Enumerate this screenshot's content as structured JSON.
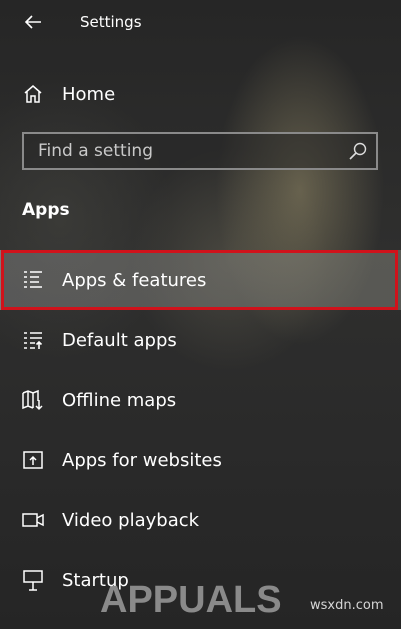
{
  "window": {
    "title": "Settings"
  },
  "home": {
    "label": "Home"
  },
  "search": {
    "placeholder": "Find a setting",
    "value": ""
  },
  "section": {
    "title": "Apps"
  },
  "nav": {
    "items": [
      {
        "label": "Apps & features",
        "icon": "apps-features-icon",
        "selected": true
      },
      {
        "label": "Default apps",
        "icon": "default-apps-icon"
      },
      {
        "label": "Offline maps",
        "icon": "offline-maps-icon"
      },
      {
        "label": "Apps for websites",
        "icon": "apps-for-websites-icon"
      },
      {
        "label": "Video playback",
        "icon": "video-playback-icon"
      },
      {
        "label": "Startup",
        "icon": "startup-icon"
      }
    ]
  },
  "colors": {
    "highlight": "#d0121b",
    "text": "#ffffff"
  },
  "watermark": {
    "brand": "APPUALS",
    "site": "wsxdn.com"
  }
}
